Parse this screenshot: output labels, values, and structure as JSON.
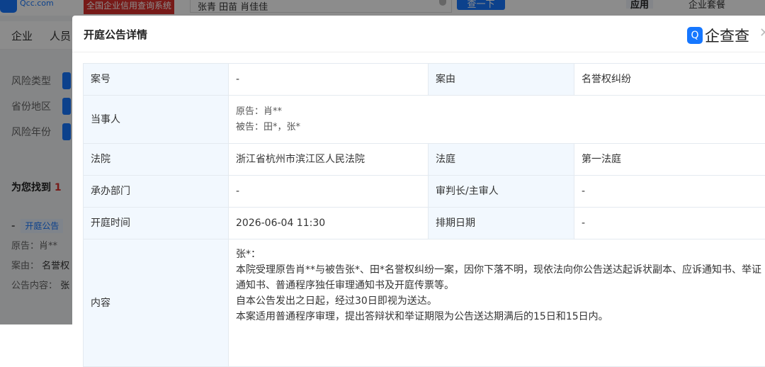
{
  "topbar": {
    "logo_text": "Qcc.com",
    "slogan": "全国企业信用查询系统",
    "search_value": "张青 田苗 肖佳佳",
    "search_button": "查一下",
    "apps": "应用",
    "package": "企业套餐"
  },
  "nav": {
    "items": [
      "企业",
      "人员"
    ]
  },
  "filters": [
    "风险类型",
    "省份地区",
    "风险年份"
  ],
  "found": {
    "prefix": "为您找到",
    "count": "1"
  },
  "result": {
    "dash": "-",
    "tag": "开庭公告",
    "plaintiff": "原告：肖**",
    "cause_label": "案由：",
    "cause": "名誉权",
    "content_label": "公告内容：",
    "content": "张"
  },
  "modal": {
    "title": "开庭公告详情",
    "brand": "企查查",
    "rows": {
      "case_no": {
        "label": "案号",
        "value": "-"
      },
      "cause": {
        "label": "案由",
        "value": "名誉权纠纷"
      },
      "parties": {
        "label": "当事人",
        "plaintiff": "原告：肖**",
        "defendant": "被告：田*，张*"
      },
      "court": {
        "label": "法院",
        "value": "浙江省杭州市滨江区人民法院"
      },
      "courtroom": {
        "label": "法庭",
        "value": "第一法庭"
      },
      "department": {
        "label": "承办部门",
        "value": "-"
      },
      "judge": {
        "label": "审判长/主审人",
        "value": "-"
      },
      "time": {
        "label": "开庭时间",
        "value": "2026-06-04 11:30"
      },
      "schedule": {
        "label": "排期日期",
        "value": "-"
      },
      "content": {
        "label": "内容",
        "lines": [
          "张*：",
          "本院受理原告肖**与被告张*、田*名誉权纠纷一案，因你下落不明，现依法向你公告送达起诉状副本、应诉通知书、举证通知书、普通程序独任审理通知书及开庭传票等。",
          "自本公告发出之日起，经过30日即视为送达。",
          "本案适用普通程序审理，提出答辩状和举证期限为公告送达期满后的15日和15日内。"
        ]
      }
    }
  }
}
